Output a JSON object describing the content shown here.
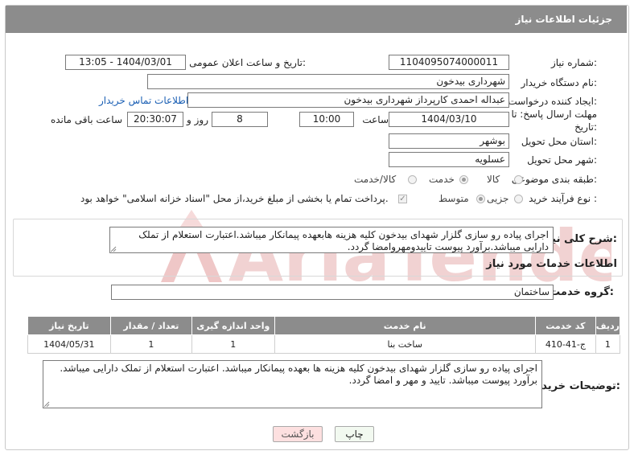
{
  "header": {
    "title": "جزئیات اطلاعات نیاز"
  },
  "form": {
    "need_number_label": "شماره نیاز:",
    "need_number": "1104095074000011",
    "announce_label": "تاریخ و ساعت اعلان عمومی:",
    "announce_value": "1404/03/01 - 13:05",
    "buyer_org_label": "نام دستگاه خریدار:",
    "buyer_org": "شهرداری بیدخون",
    "creator_label": "ایجاد کننده درخواست:",
    "creator": "عبداله احمدی کارپرداز شهرداری بیدخون",
    "contact_link": "اطلاعات تماس خریدار",
    "deadline_label_1": "مهلت ارسال پاسخ: تا",
    "deadline_label_2": "تاریخ:",
    "deadline_date": "1404/03/10",
    "time_label": "ساعت",
    "deadline_time": "10:00",
    "days_value": "8",
    "days_label": "روز و",
    "remaining_time": "20:30:07",
    "remaining_label": "ساعت باقی مانده",
    "province_label": "استان محل تحویل:",
    "province": "بوشهر",
    "city_label": "شهر محل تحویل:",
    "city": "عسلویه",
    "category_label": "طبقه بندی موضوعی:",
    "category_options": [
      "کالا",
      "خدمت",
      "کالا/خدمت"
    ],
    "category_selected": "خدمت",
    "process_label": "نوع فرآیند خرید :",
    "process_options": [
      "جزیی",
      "متوسط"
    ],
    "process_selected": "متوسط",
    "treasury_note": "پرداخت تمام یا بخشی از مبلغ خرید،از محل \"اسناد خزانه اسلامی\" خواهد بود."
  },
  "description": {
    "label": "شرح کلی نیاز:",
    "text": "اجرای پیاده رو سازی گلزار شهدای بیدخون کلیه هزینه هابعهده پیمانکار میباشد.اعتبارت استعلام از تملک دارایی میباشد.برآورد پیوست تاییدومهروامضا گردد."
  },
  "services": {
    "title": "اطلاعات خدمات مورد نیاز",
    "group_label": "گروه خدمت:",
    "group_value": "ساختمان",
    "columns": [
      "ردیف",
      "کد خدمت",
      "نام خدمت",
      "واحد اندازه گیری",
      "تعداد / مقدار",
      "تاریخ نیاز"
    ],
    "rows": [
      {
        "row": "1",
        "code": "ج-41-410",
        "name": "ساخت بنا",
        "unit": "1",
        "qty": "1",
        "date": "1404/05/31"
      }
    ]
  },
  "buyer_notes": {
    "label": "توضیحات خریدار:",
    "text": "اجرای پیاده رو سازی گلزار شهدای بیدخون کلیه هزینه ها بعهده پیمانکار میباشد. اعتبارت استعلام از تملک دارایی میباشد. برآورد پیوست میباشد. تایید و مهر و امضا گردد."
  },
  "buttons": {
    "print": "چاپ",
    "back": "بازگشت"
  },
  "watermark": {
    "text": "AriaTender.neT"
  },
  "colors": {
    "header_bg": "#8c8c8c",
    "link": "#1a5fb4",
    "watermark": "#e6b4b4",
    "back_bg": "#fde0e0",
    "print_bg": "#f2f9f0"
  }
}
